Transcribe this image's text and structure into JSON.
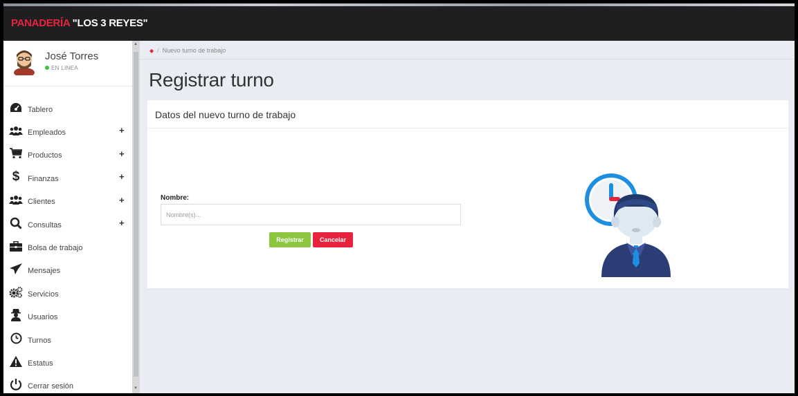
{
  "app": {
    "brand_part1": "PANADERÍA ",
    "brand_part2": "\"LOS 3 REYES\""
  },
  "user": {
    "name": "José Torres",
    "status": "EN LINEA"
  },
  "sidebar": {
    "items": [
      {
        "label": "Tablero",
        "icon": "dashboard-icon",
        "expandable": false
      },
      {
        "label": "Empleados",
        "icon": "users-icon",
        "expandable": true
      },
      {
        "label": "Productos",
        "icon": "cart-icon",
        "expandable": true
      },
      {
        "label": "Finanzas",
        "icon": "dollar-icon",
        "expandable": true
      },
      {
        "label": "Clientes",
        "icon": "users-icon",
        "expandable": true
      },
      {
        "label": "Consultas",
        "icon": "search-icon",
        "expandable": true
      },
      {
        "label": "Bolsa de trabajo",
        "icon": "briefcase-icon",
        "expandable": false
      },
      {
        "label": "Mensajes",
        "icon": "paper-plane-icon",
        "expandable": false
      },
      {
        "label": "Servicios",
        "icon": "cogs-icon",
        "expandable": false
      },
      {
        "label": "Usuarios",
        "icon": "user-secret-icon",
        "expandable": false
      },
      {
        "label": "Turnos",
        "icon": "clock-icon",
        "expandable": false
      },
      {
        "label": "Estatus",
        "icon": "warning-icon",
        "expandable": false
      },
      {
        "label": "Cerrar sesión",
        "icon": "power-icon",
        "expandable": false
      }
    ],
    "plus_symbol": "+"
  },
  "breadcrumb": {
    "separator": "/",
    "current": "Nuevo turno de trabajo"
  },
  "page": {
    "title": "Registrar turno"
  },
  "form": {
    "card_title": "Datos del nuevo turno de trabajo",
    "name_label": "Nombre:",
    "name_placeholder": "Nombre(s)...",
    "name_value": "",
    "register_label": "Registrar",
    "cancel_label": "Cancelar"
  },
  "colors": {
    "accent_red": "#e8233e",
    "success_green": "#8cc63e",
    "topbar": "#1f1f21"
  }
}
